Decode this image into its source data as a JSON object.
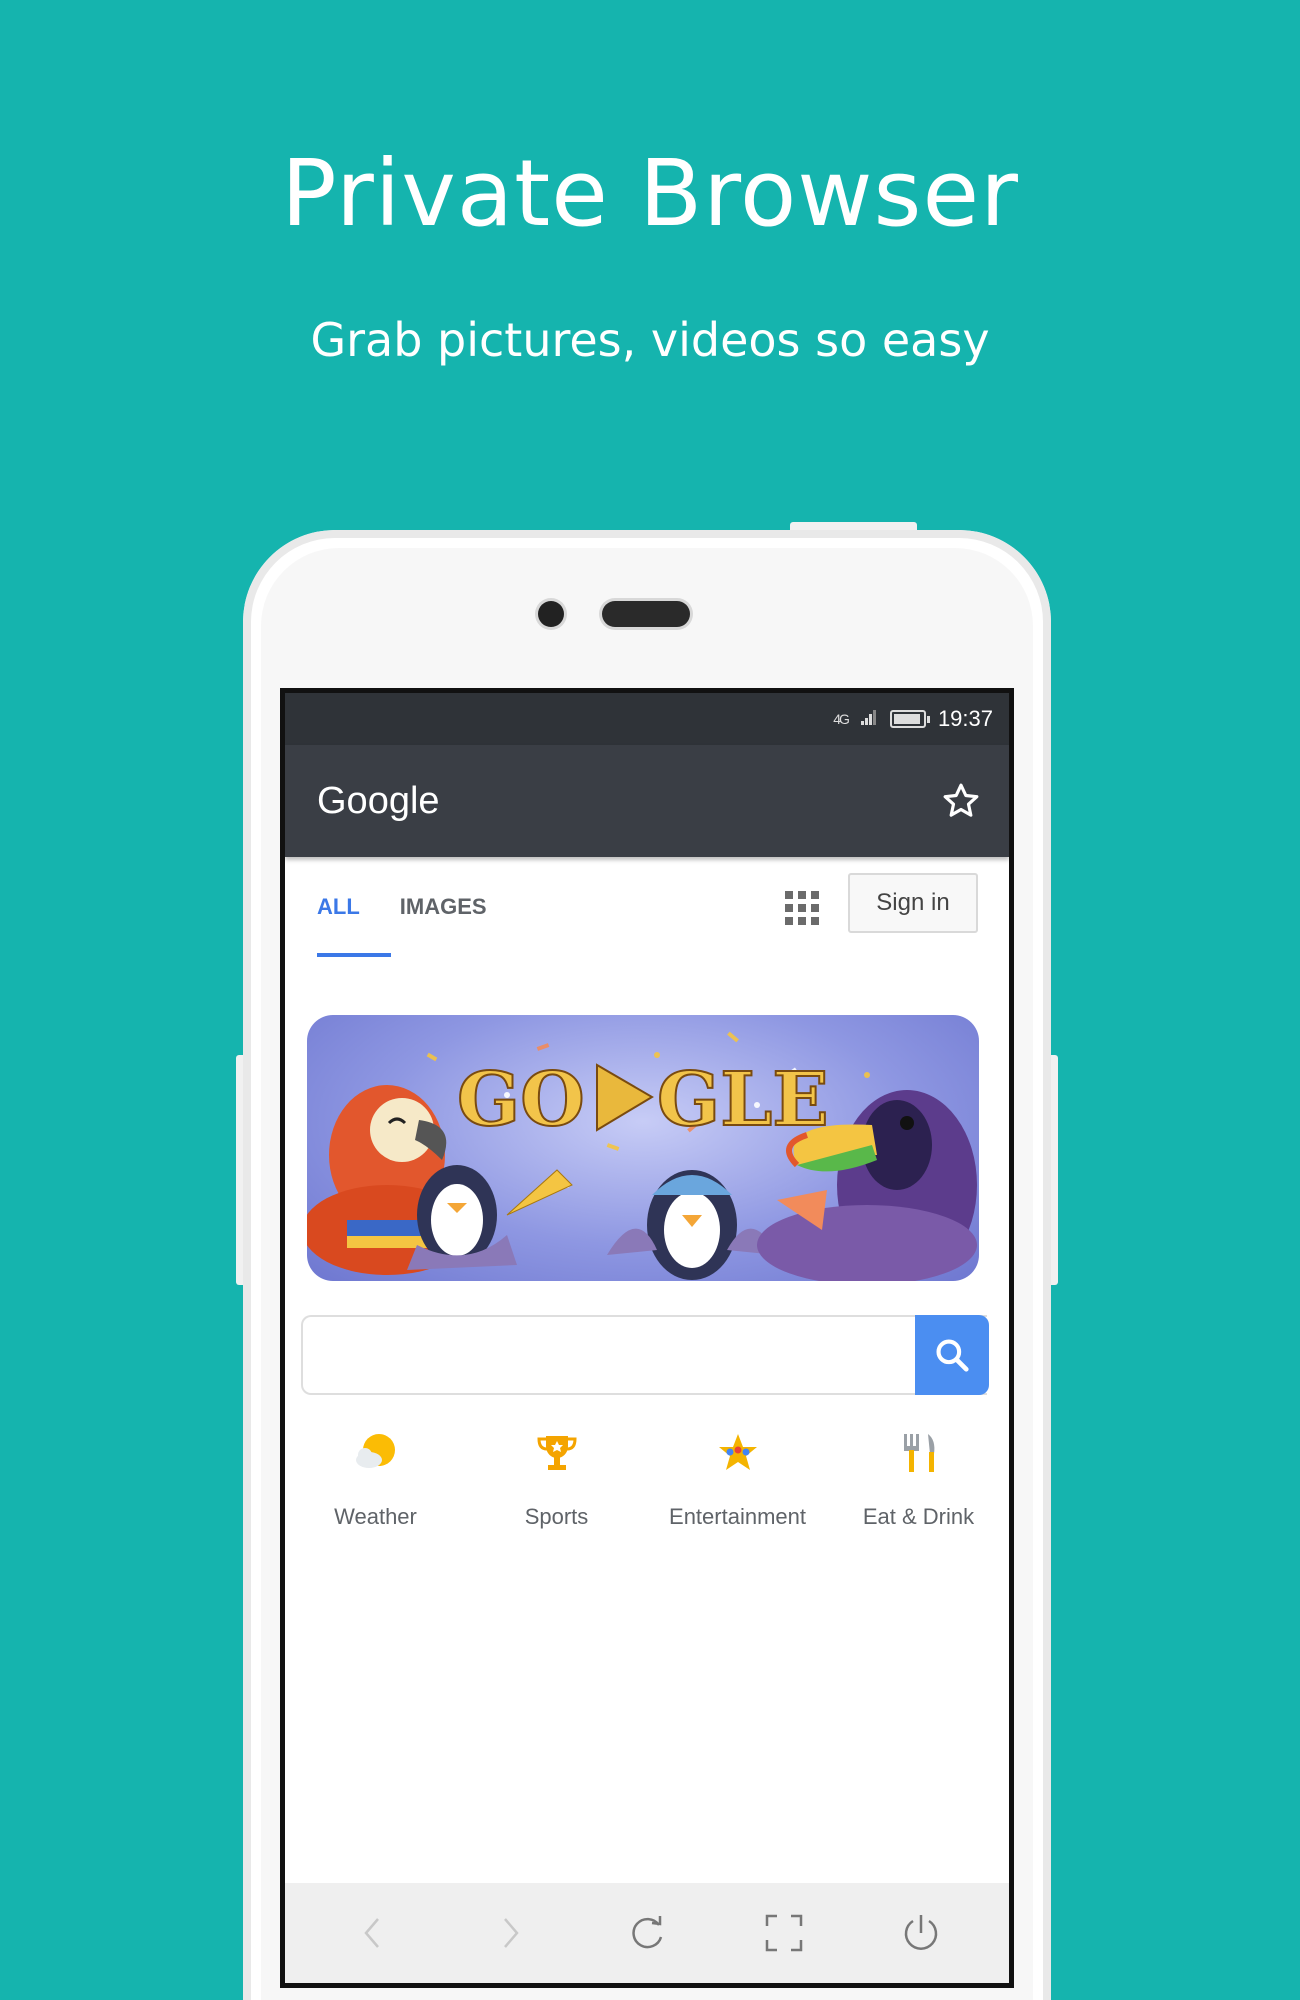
{
  "promo": {
    "title": "Private Browser",
    "subtitle": "Grab pictures, videos so easy",
    "background_color": "#15b4ae"
  },
  "status_bar": {
    "signal_label": "4G",
    "battery_icon": "battery-icon",
    "time": "19:37"
  },
  "app_bar": {
    "title": "Google",
    "bookmark_icon": "star-outline-icon"
  },
  "google_page": {
    "tabs": [
      {
        "label": "ALL",
        "active": true
      },
      {
        "label": "IMAGES",
        "active": false
      }
    ],
    "apps_icon": "apps-grid-icon",
    "sign_in_label": "Sign in",
    "doodle_text": "GOOGLE",
    "search": {
      "placeholder": "",
      "button_icon": "search-icon",
      "button_color": "#4b8ef1"
    },
    "shortcuts": [
      {
        "label": "Weather",
        "icon": "weather-icon"
      },
      {
        "label": "Sports",
        "icon": "trophy-icon"
      },
      {
        "label": "Entertainment",
        "icon": "star-icon"
      },
      {
        "label": "Eat & Drink",
        "icon": "fork-knife-icon"
      }
    ]
  },
  "bottom_nav": [
    {
      "icon": "back-icon",
      "enabled": false
    },
    {
      "icon": "forward-icon",
      "enabled": false
    },
    {
      "icon": "refresh-icon",
      "enabled": true
    },
    {
      "icon": "fullscreen-icon",
      "enabled": true
    },
    {
      "icon": "power-icon",
      "enabled": true
    }
  ]
}
